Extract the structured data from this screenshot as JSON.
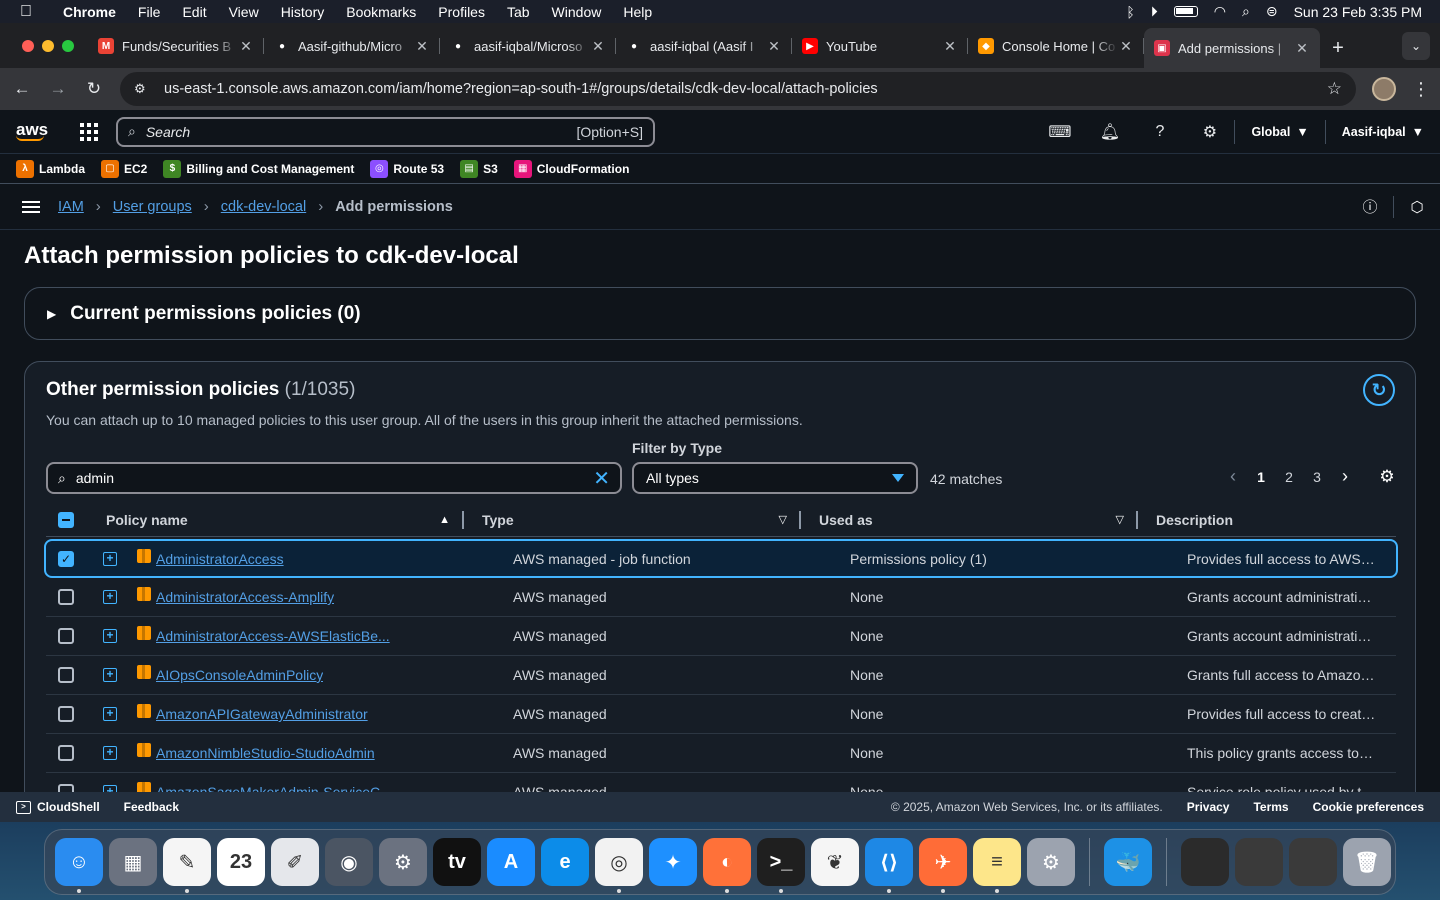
{
  "menubar": {
    "app": "Chrome",
    "items": [
      "File",
      "Edit",
      "View",
      "History",
      "Bookmarks",
      "Profiles",
      "Tab",
      "Window",
      "Help"
    ],
    "datetime": "Sun 23 Feb  3:35 PM"
  },
  "tabs": [
    {
      "title": "Funds/Securities B",
      "favicon": "gmail-icon",
      "color": "#ea4335",
      "glyph": "M"
    },
    {
      "title": "Aasif-github/Micro",
      "favicon": "github-icon",
      "color": "#ffffff",
      "glyph": "●"
    },
    {
      "title": "aasif-iqbal/Microso",
      "favicon": "github-icon",
      "color": "#ffffff",
      "glyph": "●"
    },
    {
      "title": "aasif-iqbal (Aasif I",
      "favicon": "github-icon",
      "color": "#ffffff",
      "glyph": "●"
    },
    {
      "title": "YouTube",
      "favicon": "youtube-icon",
      "color": "#ff0000",
      "glyph": "▶"
    },
    {
      "title": "Console Home | Co",
      "favicon": "aws-console-icon",
      "color": "#ff9900",
      "glyph": "◆"
    },
    {
      "title": "Add permissions |",
      "favicon": "aws-iam-icon",
      "color": "#dd344c",
      "glyph": "▣",
      "active": true
    }
  ],
  "omnibox": {
    "url": "us-east-1.console.aws.amazon.com/iam/home?region=ap-south-1#/groups/details/cdk-dev-local/attach-policies"
  },
  "awsnav": {
    "search_placeholder": "Search",
    "search_shortcut": "[Option+S]",
    "region": "Global",
    "account": "Aasif-iqbal"
  },
  "favorites": [
    {
      "label": "Lambda",
      "color": "#ed7100",
      "glyph": "λ"
    },
    {
      "label": "EC2",
      "color": "#ed7100",
      "glyph": "▢"
    },
    {
      "label": "Billing and Cost Management",
      "color": "#3f8624",
      "glyph": "$"
    },
    {
      "label": "Route 53",
      "color": "#8c4fff",
      "glyph": "◎"
    },
    {
      "label": "S3",
      "color": "#3f8624",
      "glyph": "▤"
    },
    {
      "label": "CloudFormation",
      "color": "#e7157b",
      "glyph": "▦"
    }
  ],
  "breadcrumb": {
    "items": [
      "IAM",
      "User groups",
      "cdk-dev-local"
    ],
    "current": "Add permissions"
  },
  "page": {
    "title": "Attach permission policies to cdk-dev-local",
    "current_section": "Current permissions policies (0)",
    "other_title": "Other permission policies",
    "other_count": "(1/1035)",
    "other_desc": "You can attach up to 10 managed policies to this user group. All of the users in this group inherit the attached permissions.",
    "filter_label": "Filter by Type",
    "search_value": "admin",
    "filter_value": "All types",
    "matches": "42 matches",
    "pages": [
      "1",
      "2",
      "3"
    ]
  },
  "table": {
    "headers": {
      "name": "Policy name",
      "type": "Type",
      "used": "Used as",
      "desc": "Description"
    },
    "rows": [
      {
        "name": "AdministratorAccess",
        "type": "AWS managed - job function",
        "used": "Permissions policy (1)",
        "desc": "Provides full access to AWS services an...",
        "selected": true
      },
      {
        "name": "AdministratorAccess-Amplify",
        "type": "AWS managed",
        "used": "None",
        "desc": "Grants account administrative permiss..."
      },
      {
        "name": "AdministratorAccess-AWSElasticBe...",
        "type": "AWS managed",
        "used": "None",
        "desc": "Grants account administrative permiss..."
      },
      {
        "name": "AIOpsConsoleAdminPolicy",
        "type": "AWS managed",
        "used": "None",
        "desc": "Grants full access to Amazon AI Opera..."
      },
      {
        "name": "AmazonAPIGatewayAdministrator",
        "type": "AWS managed",
        "used": "None",
        "desc": "Provides full access to create/edit/dele..."
      },
      {
        "name": "AmazonNimbleStudio-StudioAdmin",
        "type": "AWS managed",
        "used": "None",
        "desc": "This policy grants access to Amazon Ni..."
      },
      {
        "name": "AmazonSageMakerAdmin-ServiceC...",
        "type": "AWS managed",
        "used": "None",
        "desc": "Service role policy used by the AWS Se..."
      }
    ]
  },
  "footer": {
    "cloudshell": "CloudShell",
    "feedback": "Feedback",
    "copyright": "© 2025, Amazon Web Services, Inc. or its affiliates.",
    "links": [
      "Privacy",
      "Terms",
      "Cookie preferences"
    ]
  },
  "dock": {
    "apps": [
      {
        "name": "finder-icon",
        "color": "#2a8cf0",
        "glyph": "☺",
        "running": true
      },
      {
        "name": "launchpad-icon",
        "color": "#6b7280",
        "glyph": "▦"
      },
      {
        "name": "easy-notepad-icon",
        "color": "#f5f5f5",
        "glyph": "✎",
        "running": true
      },
      {
        "name": "calendar-icon",
        "color": "#ffffff",
        "glyph": "23"
      },
      {
        "name": "textedit-icon",
        "color": "#e5e7eb",
        "glyph": "✐"
      },
      {
        "name": "screenshot-icon",
        "color": "#4b5563",
        "glyph": "◉"
      },
      {
        "name": "system-settings-icon",
        "color": "#6b7280",
        "glyph": "⚙"
      },
      {
        "name": "apple-tv-icon",
        "color": "#111111",
        "glyph": "tv"
      },
      {
        "name": "app-store-icon",
        "color": "#1a8cff",
        "glyph": "A"
      },
      {
        "name": "edge-icon",
        "color": "#0c8ce9",
        "glyph": "e"
      },
      {
        "name": "chrome-icon",
        "color": "#f2f2f2",
        "glyph": "◎",
        "running": true
      },
      {
        "name": "safari-icon",
        "color": "#1e90ff",
        "glyph": "✦"
      },
      {
        "name": "firefox-icon",
        "color": "#ff7139",
        "glyph": "◐",
        "running": true
      },
      {
        "name": "terminal-icon",
        "color": "#1f1f1f",
        "glyph": ">_",
        "running": true
      },
      {
        "name": "mongodb-compass-icon",
        "color": "#f5f5f5",
        "glyph": "❦"
      },
      {
        "name": "vscode-icon",
        "color": "#1e88e5",
        "glyph": "⟨⟩",
        "running": true
      },
      {
        "name": "postman-icon",
        "color": "#ff6c37",
        "glyph": "✈",
        "running": true
      },
      {
        "name": "notes-icon",
        "color": "#fde68a",
        "glyph": "≡",
        "running": true
      },
      {
        "name": "gear-app-icon",
        "color": "#9ca3af",
        "glyph": "⚙"
      }
    ],
    "extra": [
      {
        "name": "docker-icon",
        "color": "#1d91e6",
        "glyph": "🐳"
      },
      {
        "name": "window-preview-1-icon",
        "color": "#2b2b2b",
        "glyph": ""
      },
      {
        "name": "window-preview-2-icon",
        "color": "#3a3a3a",
        "glyph": ""
      },
      {
        "name": "window-preview-3-icon",
        "color": "#3a3a3a",
        "glyph": ""
      },
      {
        "name": "trash-icon",
        "color": "#9ca3af",
        "glyph": "🗑"
      }
    ]
  }
}
